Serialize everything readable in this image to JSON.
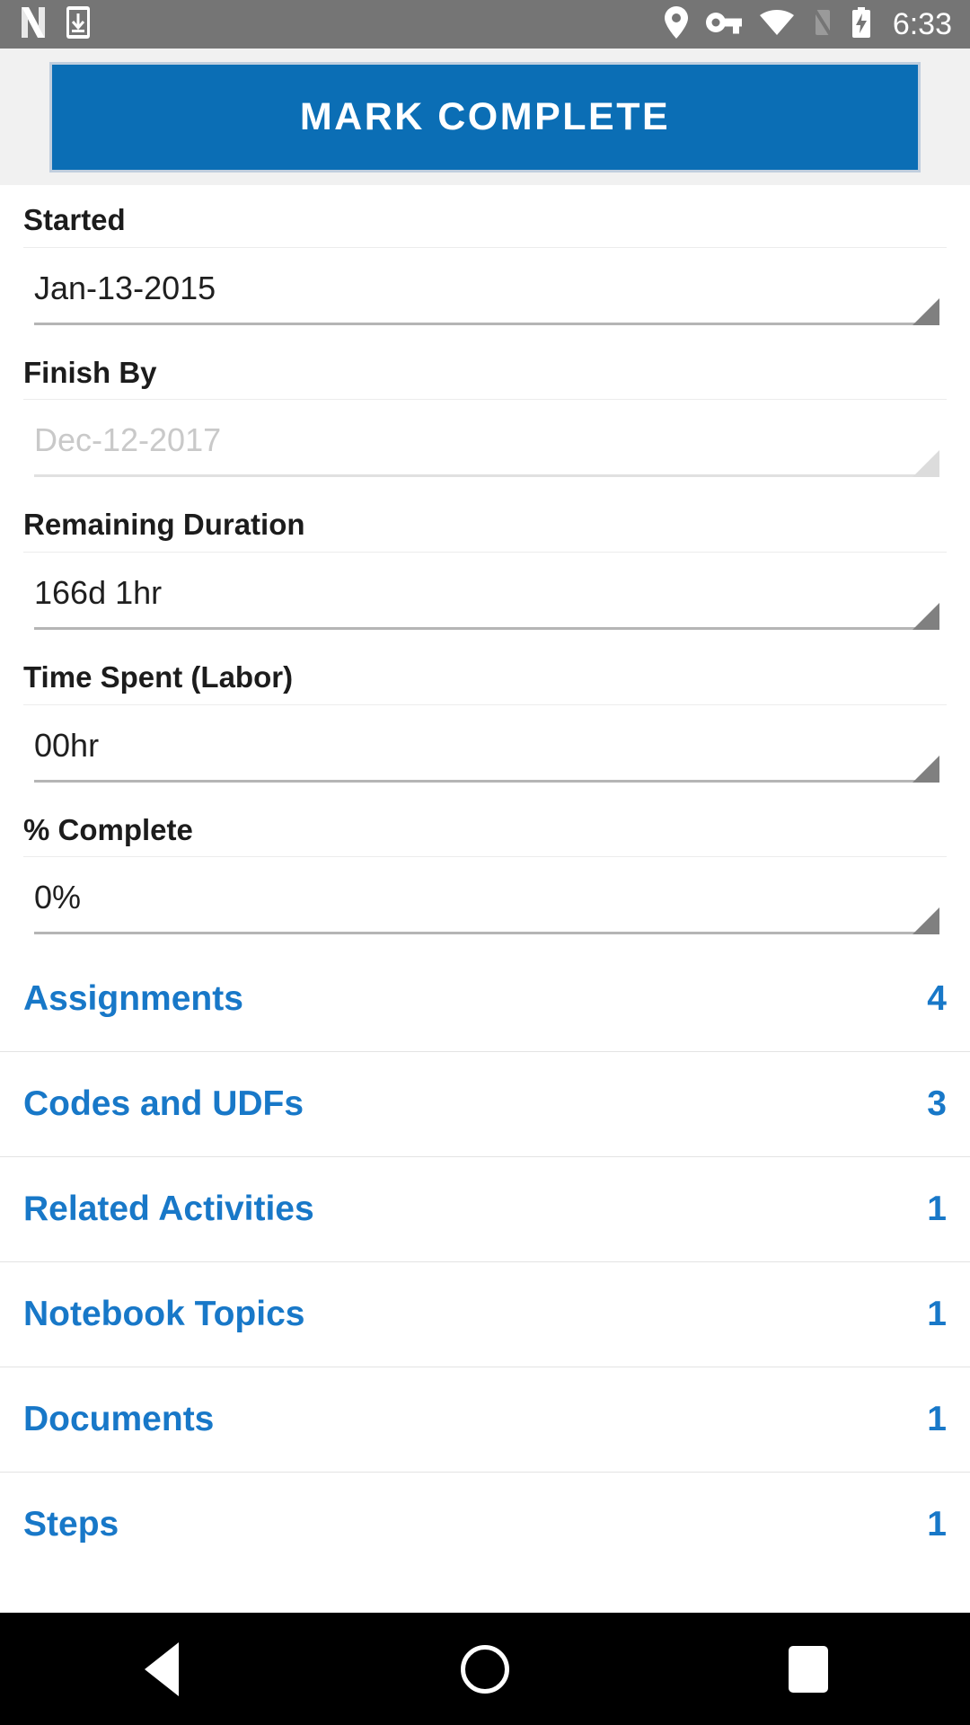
{
  "status_bar": {
    "left_icons": [
      {
        "name": "netflix-n-icon",
        "label": "N"
      },
      {
        "name": "download-icon",
        "label": "download"
      }
    ],
    "right_icons": [
      {
        "name": "location-pin-icon",
        "label": "location"
      },
      {
        "name": "vpn-key-icon",
        "label": "vpn key"
      },
      {
        "name": "wifi-icon",
        "label": "wifi"
      },
      {
        "name": "signal-off-icon",
        "label": "no signal"
      },
      {
        "name": "battery-charging-icon",
        "label": "battery charging"
      }
    ],
    "time": "6:33",
    "background_color": "#757575"
  },
  "toolbar": {
    "mark_complete_label": "MARK COMPLETE",
    "accent_color": "#0b6eb5",
    "background_color": "#f1f1f1"
  },
  "form": {
    "fields": [
      {
        "label": "Started",
        "value": "Jan-13-2015",
        "name": "started",
        "disabled": false
      },
      {
        "label": "Finish By",
        "value": "Dec-12-2017",
        "name": "finish-by",
        "disabled": true
      },
      {
        "label": "Remaining Duration",
        "value": "166d 1hr",
        "name": "remaining-duration",
        "disabled": false
      },
      {
        "label": "Time Spent (Labor)",
        "value": "00hr",
        "name": "time-spent-labor",
        "disabled": false
      },
      {
        "label": "% Complete",
        "value": "0%",
        "name": "percent-complete",
        "disabled": false
      }
    ]
  },
  "sections": {
    "link_color": "#1878c8",
    "rows": [
      {
        "label": "Assignments",
        "count": "4",
        "name": "assignments"
      },
      {
        "label": "Codes and UDFs",
        "count": "3",
        "name": "codes-and-udfs"
      },
      {
        "label": "Related Activities",
        "count": "1",
        "name": "related-activities"
      },
      {
        "label": "Notebook Topics",
        "count": "1",
        "name": "notebook-topics"
      },
      {
        "label": "Documents",
        "count": "1",
        "name": "documents"
      },
      {
        "label": "Steps",
        "count": "1",
        "name": "steps"
      }
    ]
  },
  "nav_bar": {
    "back_label": "Back",
    "home_label": "Home",
    "recents_label": "Recents"
  }
}
